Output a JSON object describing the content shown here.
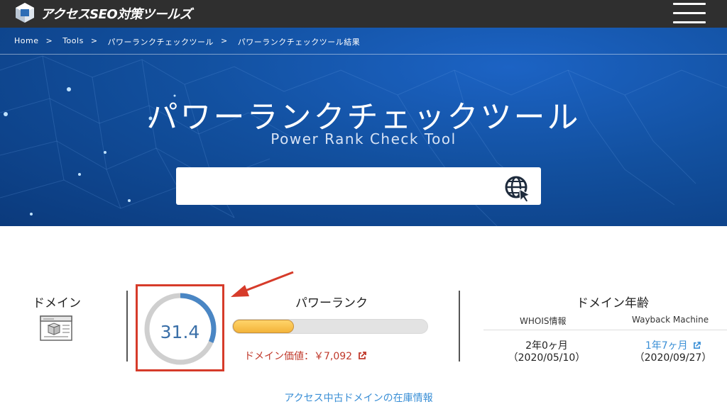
{
  "header": {
    "logo_text": "アクセスSEO対策ツールズ",
    "logo_icon": "cube-logo-icon",
    "menu_icon": "hamburger-icon"
  },
  "breadcrumb": {
    "items": [
      "Home",
      "Tools",
      "パワーランクチェックツール",
      "パワーランクチェックツール結果"
    ],
    "separator": ">"
  },
  "hero": {
    "title": "パワーランクチェックツール",
    "subtitle": "Power Rank Check Tool",
    "search_value": "",
    "search_icon": "globe-cursor-icon"
  },
  "results": {
    "domain_label": "ドメイン",
    "domain_icon": "homepage-icon",
    "score": "31.4",
    "score_fraction": 0.314,
    "power_rank_label": "パワーランク",
    "power_rank_fill": 0.314,
    "domain_value_text": "ドメイン価値：￥7,092",
    "domain_age_title": "ドメイン年齢",
    "whois_label": "WHOIS情報",
    "wayback_label": "Wayback Machine",
    "whois_age": "2年0ヶ月",
    "whois_date": "（2020/05/10）",
    "wayback_age": "1年7ヶ月",
    "wayback_date": "（2020/09/27）",
    "stock_link": "アクセス中古ドメインの在庫情報"
  },
  "colors": {
    "topbar": "#2f2f2f",
    "hero_blue": "#12509f",
    "gauge_arc": "#4a86c4",
    "gauge_track": "#cfcfcf",
    "highlight_red": "#d63b2a",
    "value_red": "#c0392b",
    "link_blue": "#3a8fd6",
    "bar_fill": "#f3b43a"
  }
}
